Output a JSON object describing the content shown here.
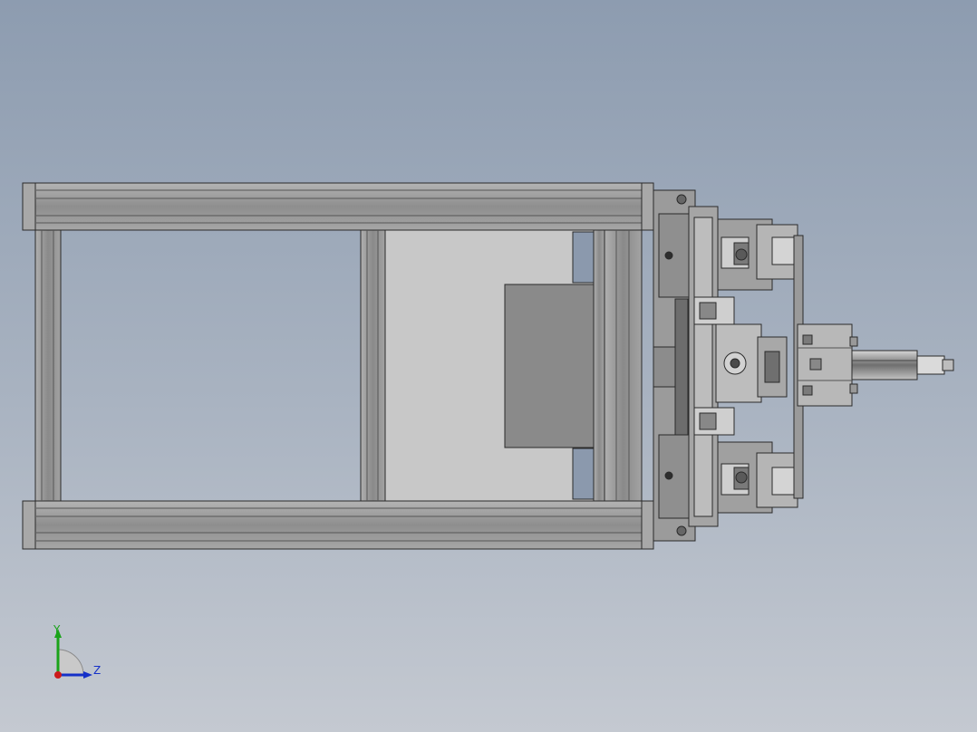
{
  "viewport": {
    "background_top": "#8d9cb0",
    "background_bottom": "#c4c9d1"
  },
  "triad": {
    "y_label": "Y",
    "z_label": "Z",
    "y_color": "#1aa31a",
    "z_color": "#1530c8",
    "x_color": "#cc1b1b"
  },
  "model": {
    "frame_color": "#9a9a9a",
    "edge_color": "#2a2a2a",
    "panel_color": "#c8c8c8",
    "mount_color": "#7f7f7f"
  }
}
